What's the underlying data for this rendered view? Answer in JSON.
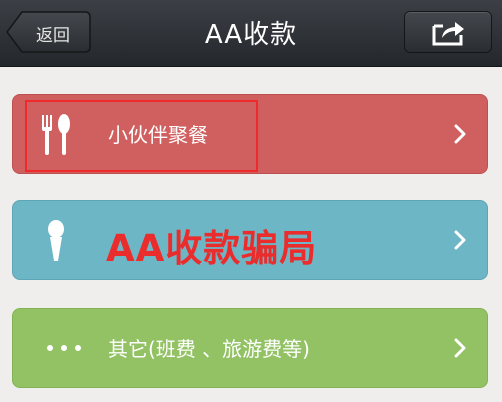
{
  "header": {
    "back_label": "返回",
    "title": "AA收款",
    "share_icon": "share-icon"
  },
  "rows": [
    {
      "label": "小伙伴聚餐",
      "icon": "fork-spoon-icon",
      "color": "#d0605f"
    },
    {
      "label": "",
      "icon": "microphone-icon",
      "color": "#6db6c6"
    },
    {
      "label": "其它(班费 、旅游费等)",
      "icon": "more-dots-icon",
      "color": "#92c264"
    }
  ],
  "overlay": {
    "caption": "AA收款骗局",
    "color": "#ea2c2c"
  }
}
